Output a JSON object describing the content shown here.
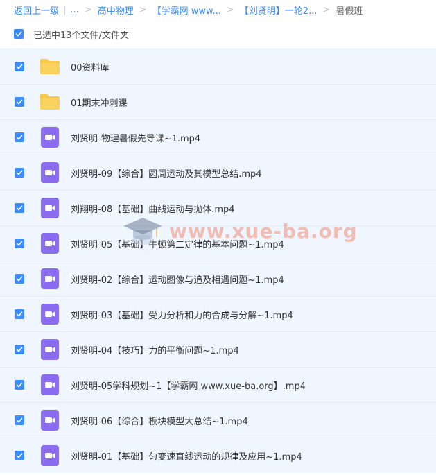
{
  "breadcrumb": {
    "back_label": "返回上一级",
    "ellipsis_label": "...",
    "crumb_1": "高中物理",
    "crumb_2": "【学霸网 www...",
    "crumb_3": "【刘贤明】一轮2...",
    "current": "暑假班"
  },
  "selection": {
    "summary": "已选中13个文件/文件夹",
    "checked": true
  },
  "files": [
    {
      "name": "00资料库",
      "type": "folder",
      "checked": true
    },
    {
      "name": "01期末冲刺课",
      "type": "folder",
      "checked": true
    },
    {
      "name": "刘贤明-物理暑假先导课~1.mp4",
      "type": "video",
      "checked": true
    },
    {
      "name": "刘贤明-09【综合】圆周运动及其模型总结.mp4",
      "type": "video",
      "checked": true
    },
    {
      "name": "刘翔明-08【基础】曲线运动与抛体.mp4",
      "type": "video",
      "checked": true
    },
    {
      "name": "刘贤明-05【基础】牛顿第二定律的基本问题~1.mp4",
      "type": "video",
      "checked": true
    },
    {
      "name": "刘贤明-02【综合】运动图像与追及相遇问题~1.mp4",
      "type": "video",
      "checked": true
    },
    {
      "name": "刘贤明-03【基础】受力分析和力的合成与分解~1.mp4",
      "type": "video",
      "checked": true
    },
    {
      "name": "刘贤明-04【技巧】力的平衡问题~1.mp4",
      "type": "video",
      "checked": true
    },
    {
      "name": "刘贤明-05学科规划~1【学霸网 www.xue-ba.org】.mp4",
      "type": "video",
      "checked": true
    },
    {
      "name": "刘贤明-06【综合】板块模型大总结~1.mp4",
      "type": "video",
      "checked": true
    },
    {
      "name": "刘贤明-01【基础】匀变速直线运动的规律及应用~1.mp4",
      "type": "video",
      "checked": true
    }
  ],
  "watermark": {
    "text": "www.xue-ba.org",
    "icon": "graduation-cap-icon"
  },
  "colors": {
    "accent": "#3b8cff",
    "row_bg": "#f0f6ff",
    "folder": "#f7c84a",
    "video": "#8a6cf0"
  }
}
